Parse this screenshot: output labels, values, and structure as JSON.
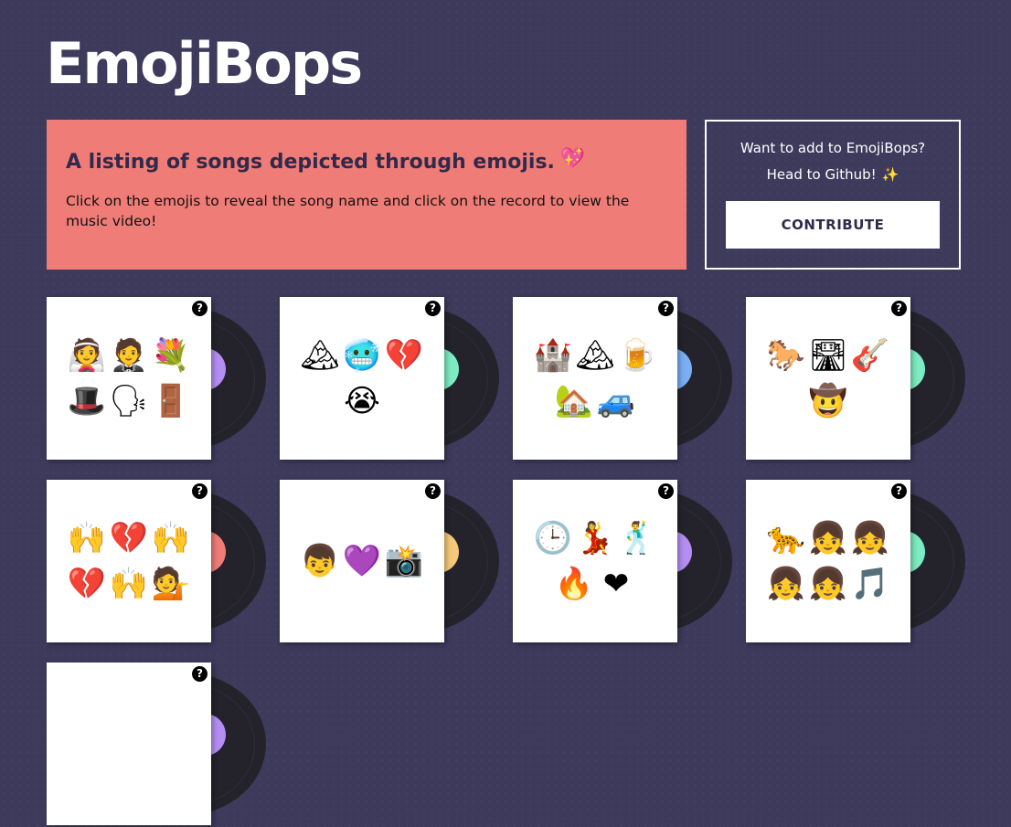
{
  "site": {
    "logo": "EmojiBops"
  },
  "intro": {
    "heading": "A listing of songs depicted through emojis.",
    "heading_emoji": "💖",
    "description": "Click on the emojis to reveal the song name and click on the record to view the music video!"
  },
  "contribute": {
    "line1": "Want to add to EmojiBops?",
    "line2": "Head to Github!",
    "line2_emoji": "✨",
    "button_label": "CONTRIBUTE"
  },
  "help_glyph": "?",
  "colors": {
    "background": "#3d3a5c",
    "intro_bg": "#f07c77",
    "heading_text": "#302a4c"
  },
  "songs": [
    {
      "row1": [
        "👰",
        "🤵",
        "💐"
      ],
      "row2": [
        "🎩",
        "🗣",
        "🚪"
      ],
      "label_color": "#b48ef3"
    },
    {
      "row1": [
        "🏔",
        "🥶",
        "💔"
      ],
      "row2": [
        "😭"
      ],
      "label_color": "#7eecc2"
    },
    {
      "row1": [
        "🏰",
        "🏔",
        "🍺"
      ],
      "row2": [
        "🏡",
        "🚙"
      ],
      "label_color": "#7aaef5"
    },
    {
      "row1": [
        "🐎",
        "🛣",
        "🎸"
      ],
      "row2": [
        "🤠"
      ],
      "label_color": "#7eecc2"
    },
    {
      "row1": [
        "🙌",
        "💔",
        "🙌"
      ],
      "row2": [
        "💔",
        "🙌",
        "💁"
      ],
      "label_color": "#f07c77"
    },
    {
      "row1": [
        "👦",
        "💜",
        "📸"
      ],
      "row2": [],
      "label_color": "#f5c97a"
    },
    {
      "row1": [
        "🕒",
        "💃",
        "🕺"
      ],
      "row2": [
        "🔥",
        "❤"
      ],
      "label_color": "#b48ef3"
    },
    {
      "row1": [
        "🐆",
        "👧",
        "👧"
      ],
      "row2": [
        "👧",
        "👧",
        "🎵"
      ],
      "label_color": "#7eecc2"
    },
    {
      "row1": [],
      "row2": [],
      "label_color": "#b48ef3"
    }
  ]
}
